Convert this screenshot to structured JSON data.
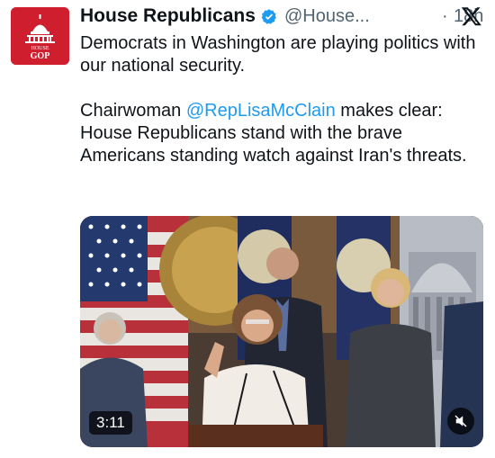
{
  "account": {
    "display_name": "House Republicans",
    "handle": "@House...",
    "separator": "·",
    "time": "18h",
    "avatar_lines": [
      "HOUSE",
      "GOP"
    ],
    "avatar_color": "#cf1f2e",
    "verified_icon": "verified-badge-icon"
  },
  "tweet": {
    "line1": "Democrats in Washington are playing politics with our national security.",
    "line2_prefix": "Chairwoman ",
    "mention": "@RepLisaMcClain",
    "line2_suffix": " makes clear: House Republicans stand with the brave Americans standing watch against Iran's threats."
  },
  "media": {
    "duration": "3:11",
    "mute_icon": "muted-speaker-icon"
  },
  "colors": {
    "text": "#0f1419",
    "secondary": "#536471",
    "link": "#1d9bf0"
  }
}
